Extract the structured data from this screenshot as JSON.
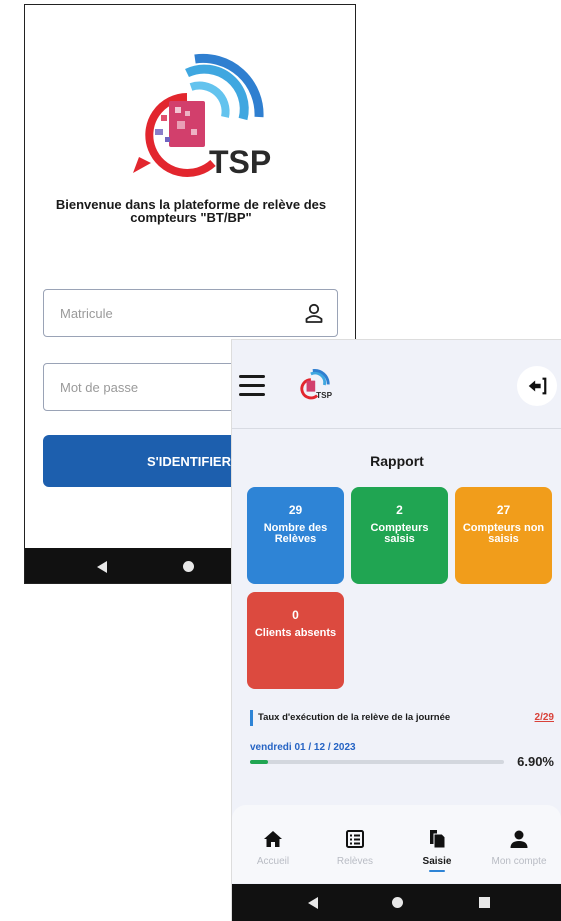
{
  "login": {
    "logo_text": "TSP",
    "welcome": "Bienvenue dans la plateforme de relève des compteurs \"BT/BP\"",
    "username_placeholder": "Matricule",
    "password_placeholder": "Mot de passe",
    "login_button": "S'IDENTIFIER",
    "icons": {
      "username": "user-icon"
    }
  },
  "dashboard": {
    "logo_text": "TSP",
    "title": "Rapport",
    "cards": [
      {
        "value": "29",
        "label": "Nombre des Relèves",
        "color": "#2e84d6"
      },
      {
        "value": "2",
        "label": "Compteurs saisis",
        "color": "#20a552"
      },
      {
        "value": "27",
        "label": "Compteurs non saisis",
        "color": "#f19d1b"
      },
      {
        "value": "0",
        "label": "Clients absents",
        "color": "#dc4a3f"
      }
    ],
    "execution_rate": {
      "label": "Taux d'exécution de la relève de la journée",
      "count": "2/29",
      "date": "vendredi 01 / 12 / 2023",
      "percent_text": "6.90%",
      "progress": 0.069
    },
    "bottom_nav": [
      {
        "label": "Accueil",
        "icon": "home-icon",
        "active": false
      },
      {
        "label": "Relèves",
        "icon": "list-icon",
        "active": false
      },
      {
        "label": "Saisie",
        "icon": "document-icon",
        "active": true
      },
      {
        "label": "Mon compte",
        "icon": "person-icon",
        "active": false
      }
    ]
  }
}
